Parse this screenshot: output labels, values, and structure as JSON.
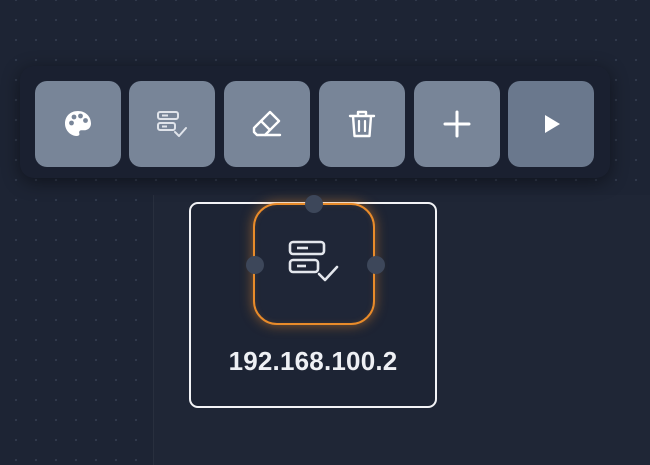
{
  "toolbar": {
    "buttons": [
      {
        "id": "color",
        "icon": "palette-icon"
      },
      {
        "id": "rules",
        "icon": "server-check-icon"
      },
      {
        "id": "edit",
        "icon": "eraser-icon"
      },
      {
        "id": "delete",
        "icon": "trash-icon"
      },
      {
        "id": "add",
        "icon": "plus-icon"
      },
      {
        "id": "run",
        "icon": "play-icon"
      }
    ]
  },
  "node": {
    "label": "192.168.100.2",
    "icon": "server-check-icon",
    "selected": true
  },
  "colors": {
    "background": "#1d2434",
    "button": "#788598",
    "accent": "#e98b2a",
    "node_border": "#f2f3f6",
    "text": "#eef0f4"
  }
}
